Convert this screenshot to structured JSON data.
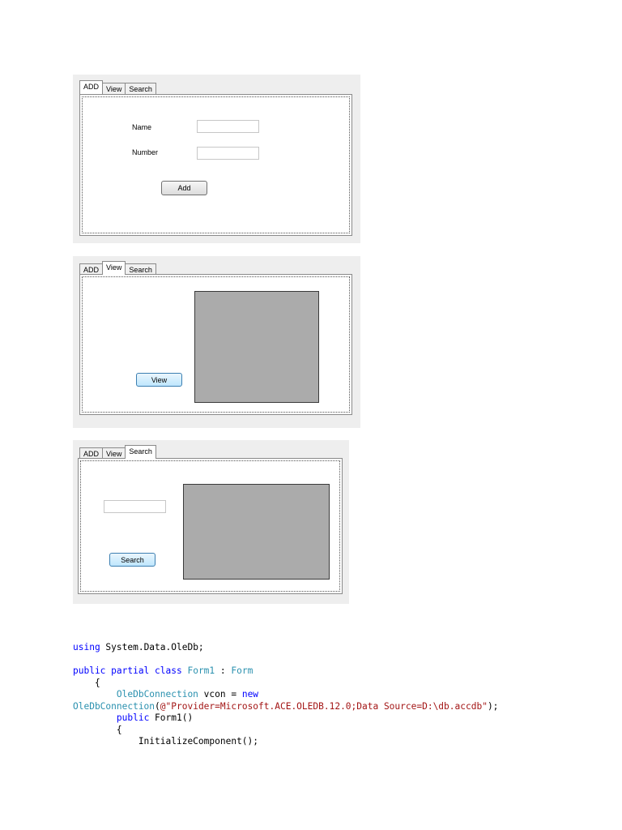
{
  "panel_add": {
    "tabs": [
      "ADD",
      "View",
      "Search"
    ],
    "active_tab": "ADD",
    "name_label": "Name",
    "number_label": "Number",
    "name_value": "",
    "number_value": "",
    "add_button": "Add"
  },
  "panel_view": {
    "tabs": [
      "ADD",
      "View",
      "Search"
    ],
    "active_tab": "View",
    "view_button": "View"
  },
  "panel_search": {
    "tabs": [
      "ADD",
      "View",
      "Search"
    ],
    "active_tab": "Search",
    "search_value": "",
    "search_button": "Search"
  },
  "code": {
    "l1_kw": "using",
    "l1_rest": " System.Data.OleDb;",
    "l2_kw": "public partial class",
    "l2_cls": "Form1",
    "l2_sep": " : ",
    "l2_base": "Form",
    "l3": "    {",
    "l4_ty": "OleDbConnection",
    "l4_mid": " vcon = ",
    "l4_kw": "new",
    "l5_ty": "OleDbConnection",
    "l5_open": "(",
    "l5_str": "@\"Provider=Microsoft.ACE.OLEDB.12.0;Data Source=D:\\db.accdb\"",
    "l5_close": ");",
    "l6_kw": "public",
    "l6_rest": " Form1()",
    "l7": "        {",
    "l8": "            InitializeComponent();"
  },
  "colors": {
    "keyword": "#0000ff",
    "type": "#2b91af",
    "string": "#a31515",
    "grid_fill": "#ababab"
  }
}
